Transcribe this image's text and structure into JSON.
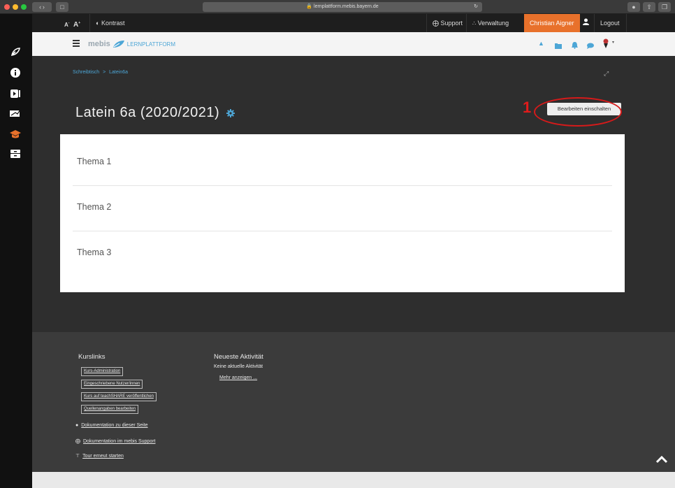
{
  "browser": {
    "url": "lernplattform.mebis.bayern.de"
  },
  "topbar": {
    "font_small": "A",
    "font_large": "A",
    "contrast_label": "Kontrast",
    "support_label": "Support",
    "admin_label": "Verwaltung",
    "user_name": "Christian Aigner",
    "logout_label": "Logout"
  },
  "navbar": {
    "brand_mebis": "mebis",
    "brand_platform": "LERNPLATTFORM"
  },
  "breadcrumb": {
    "home": "Schreibtisch",
    "separator": ">",
    "course": "Latein6a"
  },
  "course": {
    "title": "Latein 6a (2020/2021)",
    "edit_button": "Bearbeiten einschalten",
    "annotation": "1"
  },
  "topics": [
    {
      "label": "Thema 1"
    },
    {
      "label": "Thema 2"
    },
    {
      "label": "Thema 3"
    }
  ],
  "footer": {
    "courselinks_heading": "Kurslinks",
    "courselinks": [
      "Kurs-Administration",
      "Eingeschriebene Nutzer/innen",
      "Kurs auf teachSHARE veröffentlichen",
      "Quellenangaben bearbeiten"
    ],
    "doc_page": "Dokumentation zu dieser Seite",
    "doc_support": "Dokumentation im mebis Support",
    "tour": "Tour erneut starten",
    "activity_heading": "Neueste Aktivität",
    "activity_none": "Keine aktuelle Aktivität",
    "activity_more": "Mehr anzeigen ..."
  },
  "colors": {
    "accent_blue": "#4da6d6",
    "user_orange": "#e8712b",
    "annotation_red": "#d61a1a"
  }
}
